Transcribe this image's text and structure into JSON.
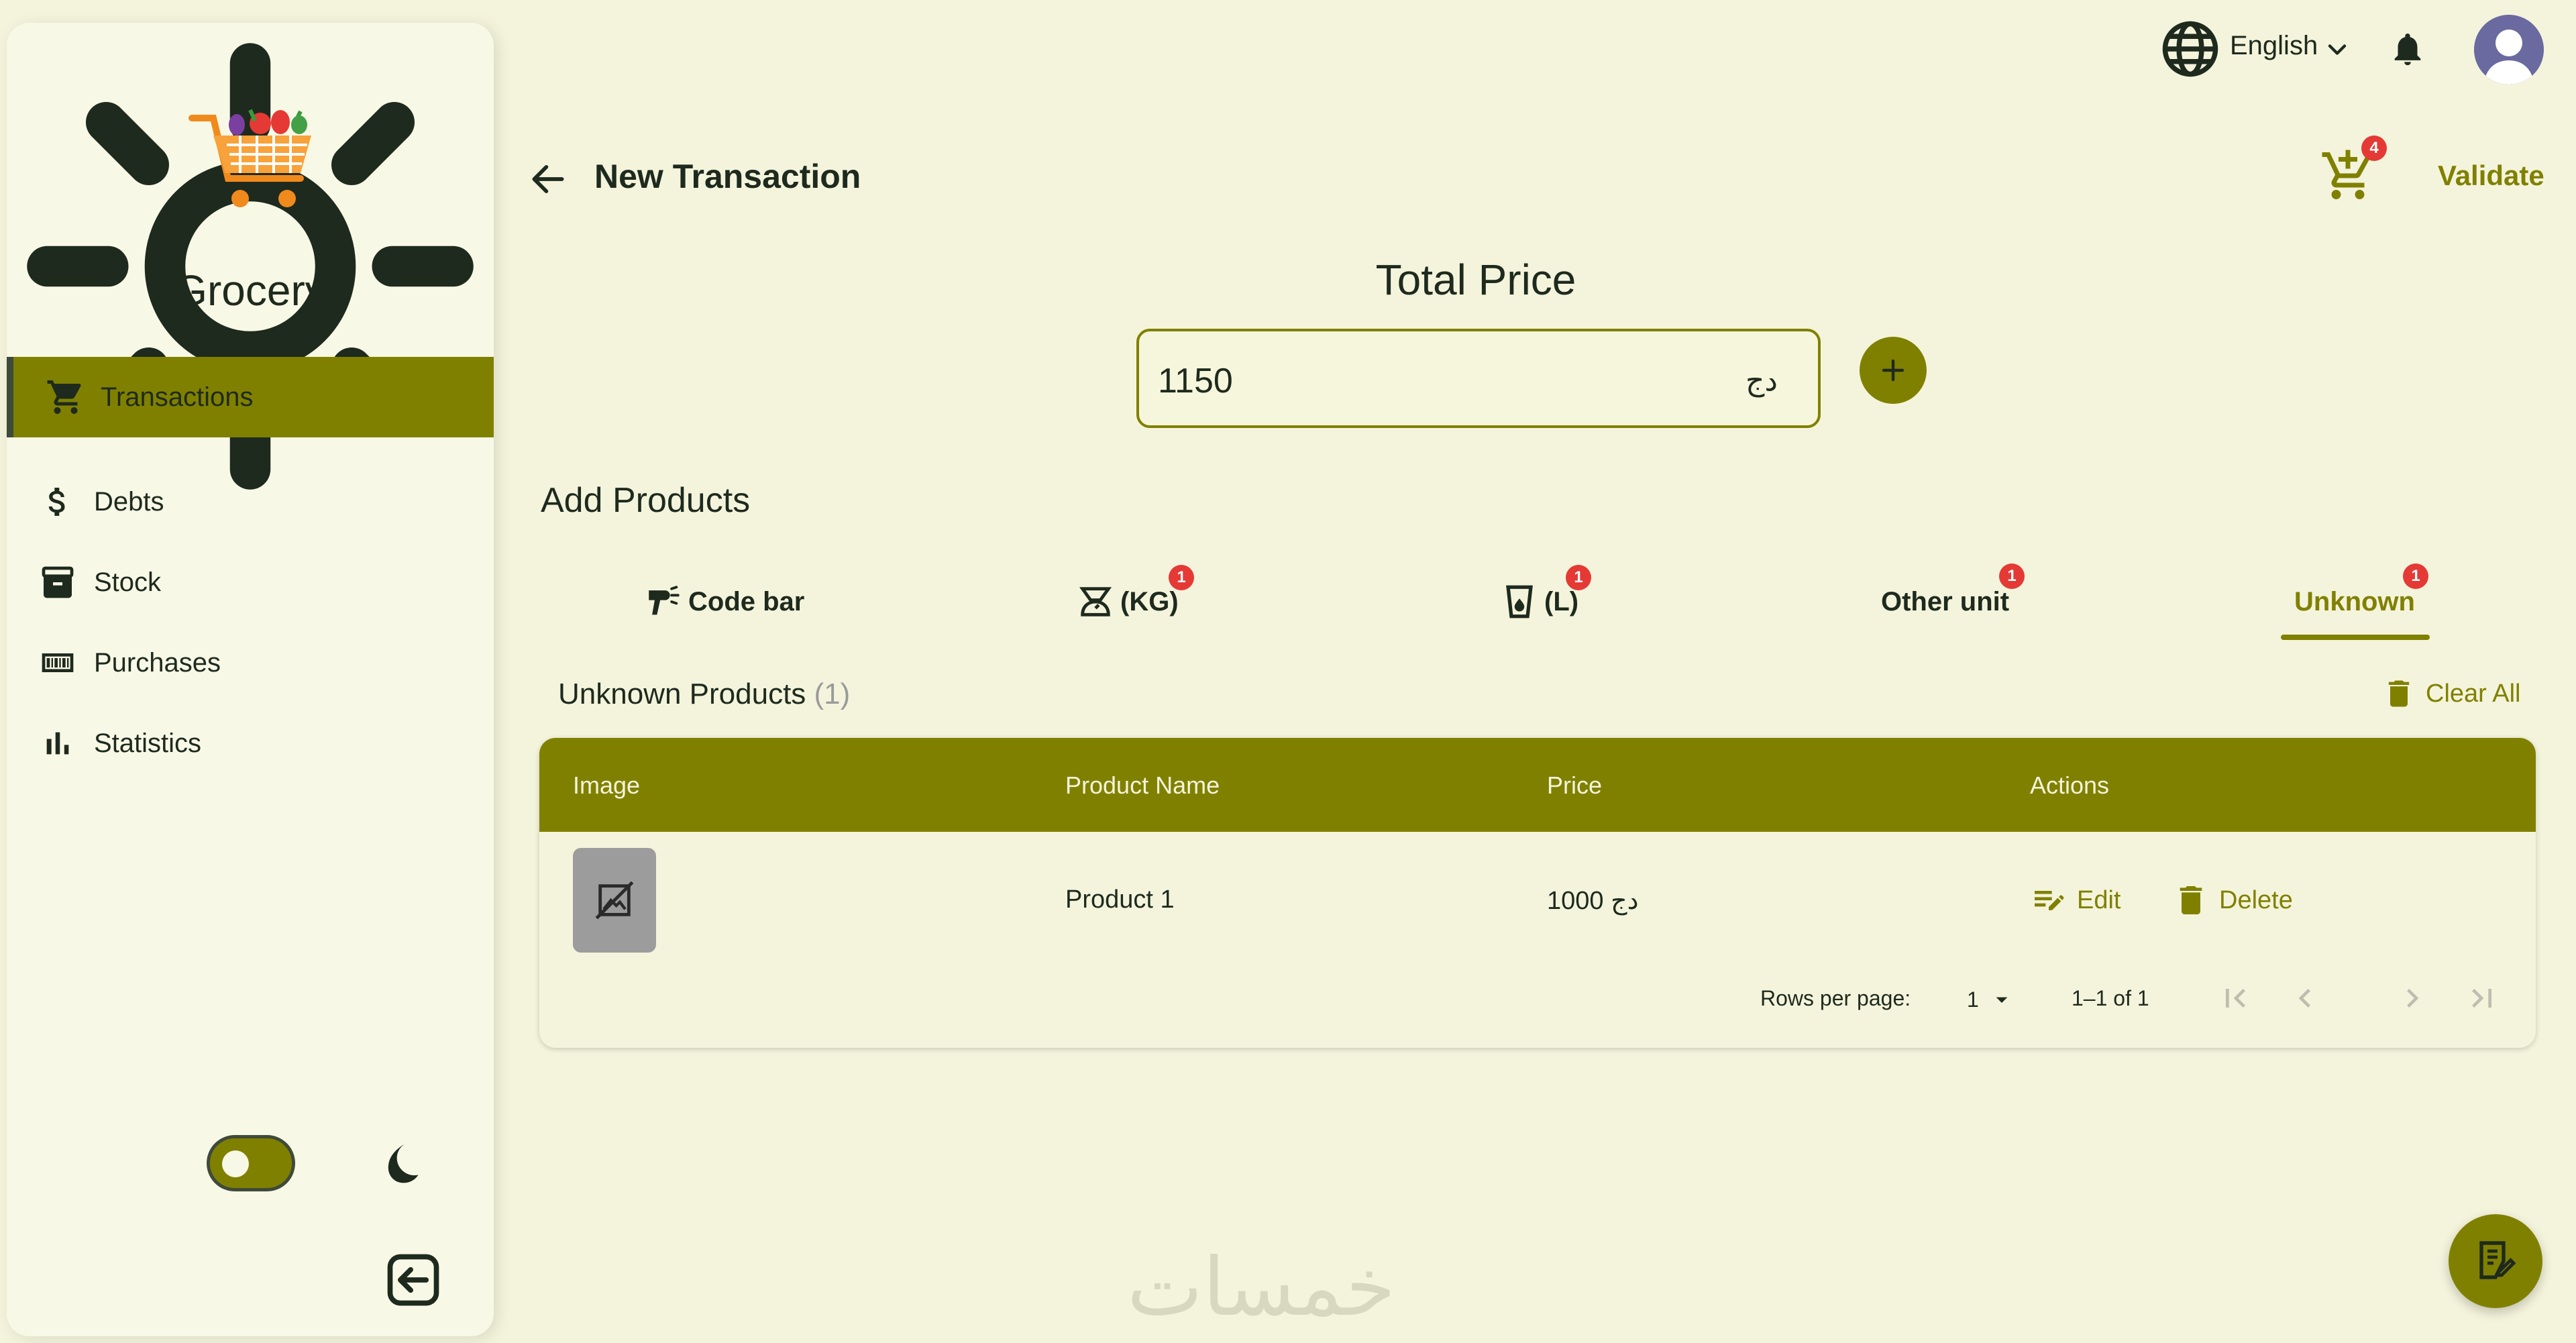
{
  "app": {
    "name": "Grocery"
  },
  "sidebar": {
    "items": [
      {
        "label": "Transactions",
        "icon": "cart-icon",
        "active": true
      },
      {
        "label": "Debts",
        "icon": "dollar-icon"
      },
      {
        "label": "Stock",
        "icon": "archive-icon"
      },
      {
        "label": "Purchases",
        "icon": "barcode-icon"
      },
      {
        "label": "Statistics",
        "icon": "bar-chart-icon"
      }
    ],
    "theme_toggle": {
      "mode": "light"
    }
  },
  "topbar": {
    "language": "English"
  },
  "header": {
    "title": "New Transaction",
    "cart_count": "4",
    "validate_label": "Validate"
  },
  "total": {
    "title": "Total Price",
    "value": "1150",
    "currency": "دج"
  },
  "products": {
    "title": "Add Products",
    "tabs": [
      {
        "label": "Code bar",
        "icon": "barcode-scanner-icon",
        "badge": ""
      },
      {
        "label": "(KG)",
        "icon": "scale-icon",
        "badge": "1"
      },
      {
        "label": "(L)",
        "icon": "liquid-cup-icon",
        "badge": "1"
      },
      {
        "label": "Other unit",
        "icon": "",
        "badge": "1"
      },
      {
        "label": "Unknown",
        "icon": "",
        "badge": "1",
        "active": true
      }
    ]
  },
  "unknown_section": {
    "title": "Unknown Products",
    "count": "(1)",
    "clear_label": "Clear All"
  },
  "table": {
    "columns": [
      "Image",
      "Product Name",
      "Price",
      "Actions"
    ],
    "rows": [
      {
        "name": "Product 1",
        "price": "1000 دج",
        "edit_label": "Edit",
        "delete_label": "Delete"
      }
    ],
    "pagination": {
      "rows_per_page_label": "Rows per page:",
      "rows_per_page": "1",
      "range": "1–1 of 1"
    }
  },
  "watermark": "خمسات",
  "colors": {
    "accent": "#808000",
    "background": "#f4f4dc",
    "badge": "#e53935"
  }
}
